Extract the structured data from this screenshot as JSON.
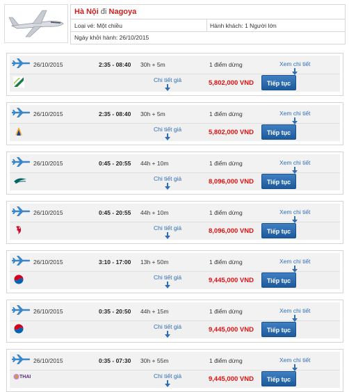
{
  "header": {
    "origin": "Hà Nội",
    "connector": "đi",
    "destination": "Nagoya",
    "ticket_type": "Loại vé: Một chiều",
    "passengers": "Hành khách: 1 Người lớn",
    "departure_date": "Ngày khởi hành: 26/10/2015"
  },
  "labels": {
    "detail": "Xem chi tiết",
    "price_detail": "Chi tiết giá",
    "continue": "Tiếp tục"
  },
  "flights": [
    {
      "date": "26/10/2015",
      "time": "2:35 - 08:40",
      "duration": "30h + 5m",
      "stops": "1 điểm dừng",
      "price": "5,802,000 VND",
      "airline_icon": "green-bird-logo-icon"
    },
    {
      "date": "26/10/2015",
      "time": "2:35 - 08:40",
      "duration": "30h + 5m",
      "stops": "1 điểm dừng",
      "price": "5,802,000 VND",
      "airline_icon": "singapore-airlines-logo-icon"
    },
    {
      "date": "26/10/2015",
      "time": "0:45 - 20:55",
      "duration": "44h + 10m",
      "stops": "1 điểm dừng",
      "price": "8,096,000 VND",
      "airline_icon": "cathay-pacific-logo-icon"
    },
    {
      "date": "26/10/2015",
      "time": "0:45 - 20:55",
      "duration": "44h + 10m",
      "stops": "1 điểm dừng",
      "price": "8,096,000 VND",
      "airline_icon": "dragonair-logo-icon"
    },
    {
      "date": "26/10/2015",
      "time": "3:10 - 17:00",
      "duration": "13h + 50m",
      "stops": "1 điểm dừng",
      "price": "9,445,000 VND",
      "airline_icon": "korean-air-logo-icon"
    },
    {
      "date": "26/10/2015",
      "time": "0:35 - 20:50",
      "duration": "44h + 15m",
      "stops": "1 điểm dừng",
      "price": "9,445,000 VND",
      "airline_icon": "korean-air-logo-icon"
    },
    {
      "date": "26/10/2015",
      "time": "0:35 - 07:30",
      "duration": "30h + 55m",
      "stops": "1 điểm dừng",
      "price": "9,445,000 VND",
      "airline_icon": "thai-airways-logo-icon",
      "airline_logo_text": "THAI"
    }
  ],
  "colors": {
    "accent_blue": "#2f6db5",
    "price_red": "#e01010",
    "city_red": "#cc1f1f"
  }
}
